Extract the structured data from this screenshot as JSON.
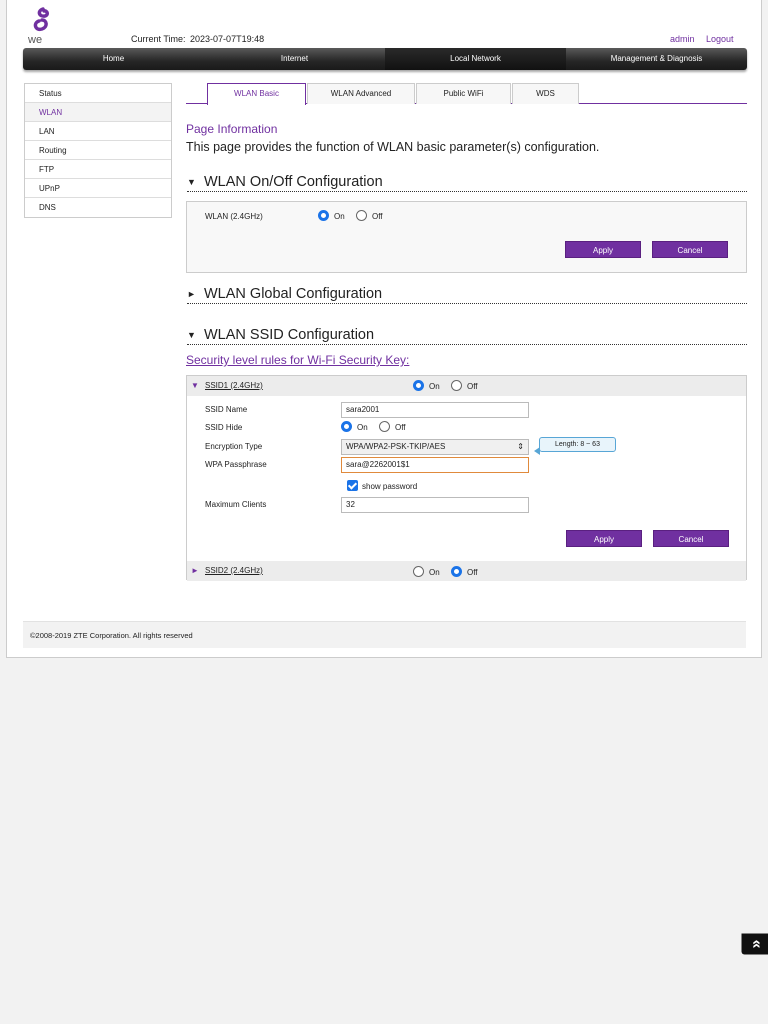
{
  "header": {
    "logo_text": "we",
    "current_time_label": "Current Time:",
    "current_time_value": "2023-07-07T19:48",
    "user": "admin",
    "logout": "Logout"
  },
  "nav": [
    "Home",
    "Internet",
    "Local Network",
    "Management & Diagnosis"
  ],
  "nav_active": "Local Network",
  "sidebar": [
    "Status",
    "WLAN",
    "LAN",
    "Routing",
    "FTP",
    "UPnP",
    "DNS"
  ],
  "sidebar_active": "WLAN",
  "tabs": [
    "WLAN Basic",
    "WLAN Advanced",
    "Public WiFi",
    "WDS"
  ],
  "tabs_active": "WLAN Basic",
  "page_info": {
    "title": "Page Information",
    "description": "This page provides the function of WLAN basic parameter(s) configuration."
  },
  "sections": {
    "onoff": "WLAN On/Off Configuration",
    "global": "WLAN Global Configuration",
    "ssid": "WLAN SSID Configuration"
  },
  "wlan_onoff": {
    "label": "WLAN (2.4GHz)",
    "on": "On",
    "off": "Off",
    "selected": "On",
    "apply": "Apply",
    "cancel": "Cancel"
  },
  "security_link": "Security level rules for Wi-Fi Security Key:",
  "ssid1": {
    "title": "SSID1 (2.4GHz)",
    "state": "On",
    "on": "On",
    "off": "Off",
    "ssid_name_label": "SSID Name",
    "ssid_name_value": "sara2001",
    "ssid_hide_label": "SSID Hide",
    "ssid_hide_state": "On",
    "encryption_label": "Encryption Type",
    "encryption_value": "WPA/WPA2-PSK-TKIP/AES",
    "passphrase_label": "WPA Passphrase",
    "passphrase_value": "sara@2262001$1",
    "length_hint": "Length: 8 ~ 63",
    "show_password_label": "show password",
    "show_password_checked": true,
    "max_clients_label": "Maximum Clients",
    "max_clients_value": "32",
    "apply": "Apply",
    "cancel": "Cancel"
  },
  "ssid2": {
    "title": "SSID2 (2.4GHz)",
    "state": "Off",
    "on": "On",
    "off": "Off"
  },
  "footer": "©2008-2019 ZTE Corporation. All rights reserved",
  "colors": {
    "accent": "#7030a0",
    "radio_selected": "#1a73e8",
    "nav_bg": "#262626"
  },
  "icons": {
    "logo": "we-logo-icon",
    "expanded": "triangle-down-icon",
    "collapsed": "triangle-right-icon",
    "scroll_top": "double-chevron-up-icon"
  }
}
